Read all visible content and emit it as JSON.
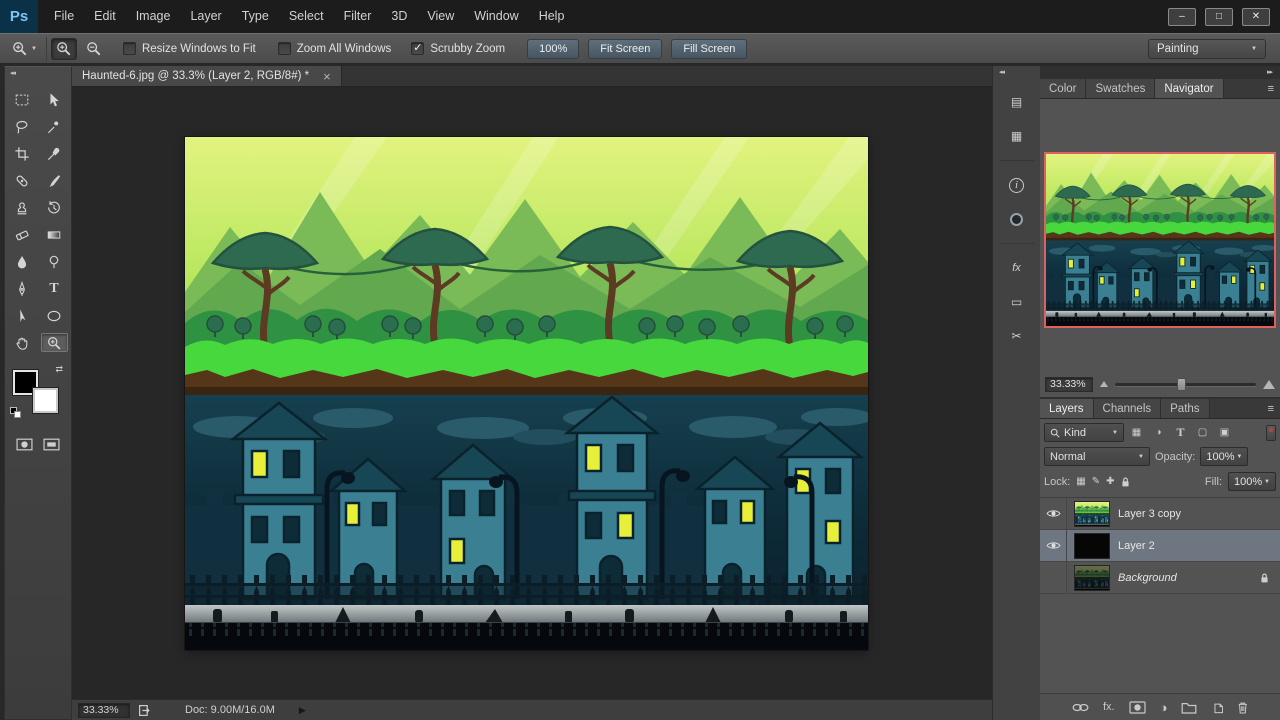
{
  "app": {
    "name": "Ps"
  },
  "menubar": {
    "items": [
      "File",
      "Edit",
      "Image",
      "Layer",
      "Type",
      "Select",
      "Filter",
      "3D",
      "View",
      "Window",
      "Help"
    ]
  },
  "window_controls": {
    "minimize": "–",
    "maximize": "□",
    "close": "✕"
  },
  "options_bar": {
    "resize_windows_label": "Resize Windows to Fit",
    "zoom_all_label": "Zoom All Windows",
    "scrubby_label": "Scrubby Zoom",
    "btn_100": "100%",
    "btn_fit": "Fit Screen",
    "btn_fill": "Fill Screen",
    "workspace": "Painting"
  },
  "document": {
    "tab_title": "Haunted-6.jpg @ 33.3% (Layer 2, RGB/8#) *",
    "close_glyph": "×"
  },
  "status_bar": {
    "zoom": "33.33%",
    "doc_size": "Doc: 9.00M/16.0M"
  },
  "navigator": {
    "tab_color": "Color",
    "tab_swatches": "Swatches",
    "tab_navigator": "Navigator",
    "zoom_value": "33.33%"
  },
  "layers_panel": {
    "tab_layers": "Layers",
    "tab_channels": "Channels",
    "tab_paths": "Paths",
    "filter_label": "Kind",
    "blend_mode": "Normal",
    "opacity_label": "Opacity:",
    "opacity_value": "100%",
    "lock_label": "Lock:",
    "fill_label": "Fill:",
    "fill_value": "100%",
    "layers": [
      {
        "name": "Layer 3 copy"
      },
      {
        "name": "Layer 2"
      },
      {
        "name": "Background"
      }
    ],
    "fx_label": "fx."
  },
  "glyphs": {
    "dropdown": "▼",
    "check": "✓",
    "collapse_right": "▸▸",
    "collapse_left": "◂◂",
    "panel_menu": "≡",
    "adjustment": "◑",
    "triangle_right": "▶",
    "filter_pixel": "▦",
    "filter_adjust": "◑",
    "filter_type": "T",
    "filter_shape": "▢",
    "filter_smart": "▣",
    "dock_properties": "▤",
    "dock_clone": "▦",
    "dock_info": "i",
    "dock_styles": "fx",
    "dock_measure": "▭",
    "dock_notes": "✂",
    "lock_transparency": "▦",
    "lock_brush": "✎",
    "lock_move": "✚",
    "swap_colors": "⇄",
    "tool_type": "T"
  },
  "colors": {
    "button_blue": "#51626f",
    "selected_layer": "#6e7681",
    "navigator_border": "#e05f5f",
    "ps_logo_blue": "#7cc5ef"
  }
}
